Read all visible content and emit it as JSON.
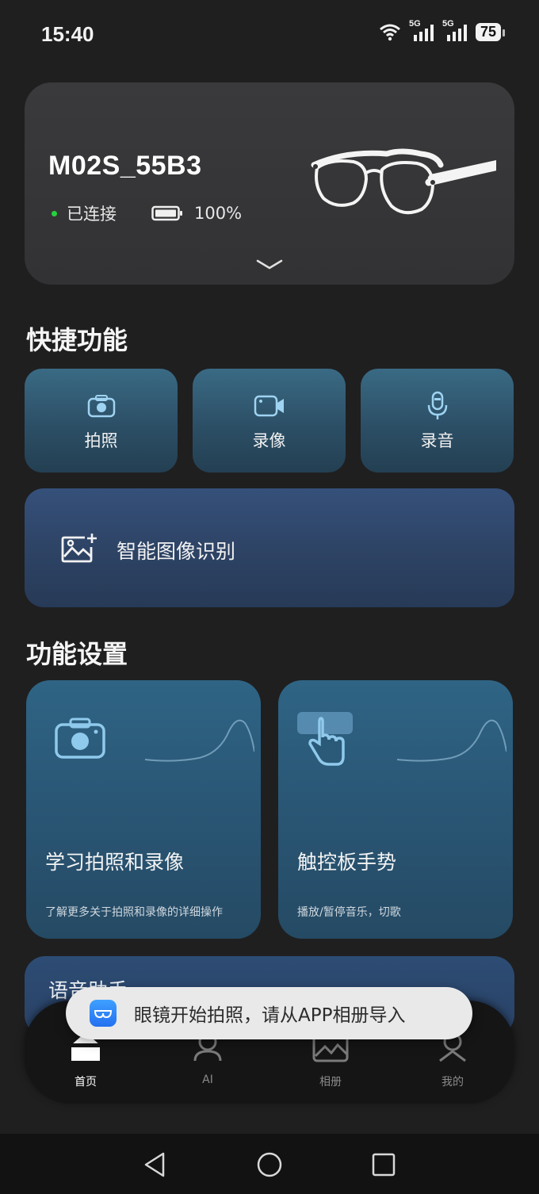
{
  "status_bar": {
    "time": "15:40",
    "signal_label_1": "5G",
    "signal_label_2": "5G",
    "battery": "75"
  },
  "device": {
    "name": "M02S_55B3",
    "connection_status": "已连接",
    "battery_percent": "100%",
    "status_color": "#25d33a"
  },
  "quick_functions": {
    "title": "快捷功能",
    "items": [
      {
        "label": "拍照",
        "icon": "camera-icon"
      },
      {
        "label": "录像",
        "icon": "video-camera-icon"
      },
      {
        "label": "录音",
        "icon": "microphone-icon"
      }
    ]
  },
  "smart_recognition": {
    "label": "智能图像识别",
    "icon": "image-sparkle-icon"
  },
  "function_settings": {
    "title": "功能设置",
    "cards": [
      {
        "title": "学习拍照和录像",
        "description": "了解更多关于拍照和录像的详细操作",
        "icon": "camera-icon"
      },
      {
        "title": "触控板手势",
        "description": "播放/暂停音乐，切歌",
        "icon": "touch-hand-icon"
      }
    ],
    "voice_assistant": "语音助手"
  },
  "toast": {
    "message": "眼镜开始拍照，请从APP相册导入"
  },
  "tab_bar": {
    "items": [
      {
        "label": "首页",
        "icon": "home-icon",
        "active": true
      },
      {
        "label": "AI",
        "icon": "ai-robot-icon",
        "active": false
      },
      {
        "label": "相册",
        "icon": "gallery-icon",
        "active": false
      },
      {
        "label": "我的",
        "icon": "profile-icon",
        "active": false
      }
    ]
  },
  "nav_bar": {
    "buttons": [
      "back-icon",
      "home-circle-icon",
      "recents-icon"
    ]
  },
  "colors": {
    "background": "#1f1f20",
    "quick_button": "#2f5a74",
    "smart_card": "#2e4466",
    "feature_card": "#2a5776"
  }
}
